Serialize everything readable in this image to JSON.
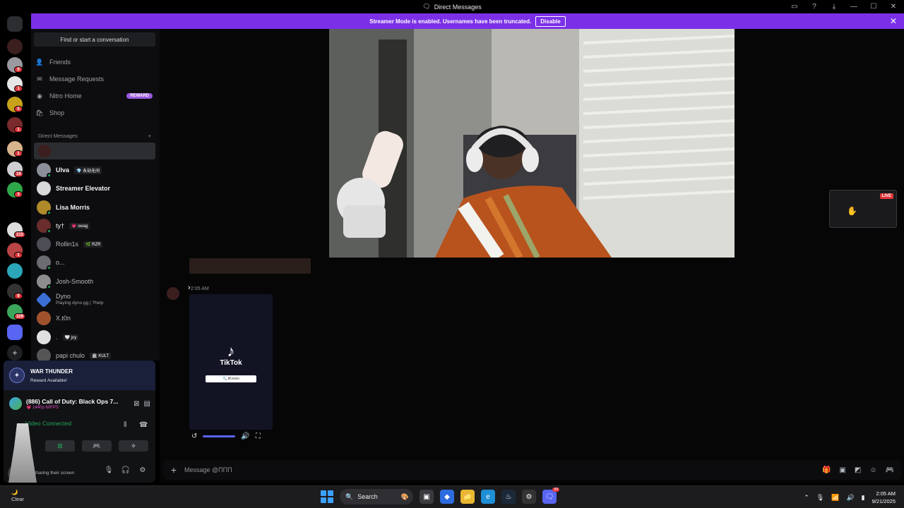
{
  "window": {
    "title": "Direct Messages"
  },
  "banner": {
    "text": "Streamer Mode is enabled. Usernames have been truncated.",
    "button": "Disable"
  },
  "rail": {
    "badges": [
      "9",
      "1",
      "5",
      "1",
      "1",
      "19",
      "3",
      "215",
      "1",
      "9",
      "329"
    ]
  },
  "sidebar": {
    "search": "Find or start a conversation",
    "nav": [
      {
        "label": "Friends",
        "icon": "friends-icon"
      },
      {
        "label": "Message Requests",
        "icon": "mail-icon"
      },
      {
        "label": "Nitro Home",
        "icon": "nitro-icon",
        "badge": "REWARD"
      },
      {
        "label": "Shop",
        "icon": "shop-icon"
      }
    ],
    "dm_header": "Direct Messages",
    "dm_add": "+",
    "dms": [
      {
        "name": "Ulva",
        "tag": "💎 永劫无间",
        "color": "#8a8f99"
      },
      {
        "name": "Streamer Elevator",
        "tag": "",
        "color": "#d9d9d9"
      },
      {
        "name": "Lisa Morris",
        "tag": "",
        "color": "#b08a2a"
      },
      {
        "name": "ty†",
        "tag": "💗 swag",
        "color": "#6a2c2c"
      },
      {
        "name": "Rollin1s",
        "tag": "🌿 RZR",
        "color": "#4d4d55"
      },
      {
        "name": "o...",
        "tag": "",
        "color": "#6b6b72"
      },
      {
        "name": "Josh-Smooth",
        "tag": "",
        "color": "#8d8d8d"
      },
      {
        "name": "Dyno",
        "tag": "",
        "sub": "Playing dyno.gg | ?help",
        "color": "#3b6fd4"
      },
      {
        "name": "X.t0n",
        "tag": "",
        "color": "#a0522d"
      },
      {
        "name": ".",
        "tag": "🤍 joy",
        "color": "#e0e0e0"
      },
      {
        "name": "papi chulo",
        "tag": "🏛 KULT",
        "color": "#555"
      }
    ]
  },
  "panel": {
    "reward_title": "WAR THUNDER",
    "reward_sub": "Reward Available!",
    "game": "(886) Call of Duty: Black Ops 7...",
    "game_sub": "💗 1440p 60FPS",
    "voice": "Video Connected",
    "sharing": "Sharing their screen"
  },
  "main": {
    "time": "2:05 AM",
    "tiktok_name": "TikTok",
    "tiktok_search": "🔍 ttf.even",
    "pip_live": "LIVE",
    "composer_placeholder": "Message @ΠΠΠ"
  },
  "taskbar": {
    "search": "Search",
    "time": "2:05 AM",
    "date": "9/21/2025",
    "weather": "Clear",
    "discord_badge": "94"
  }
}
